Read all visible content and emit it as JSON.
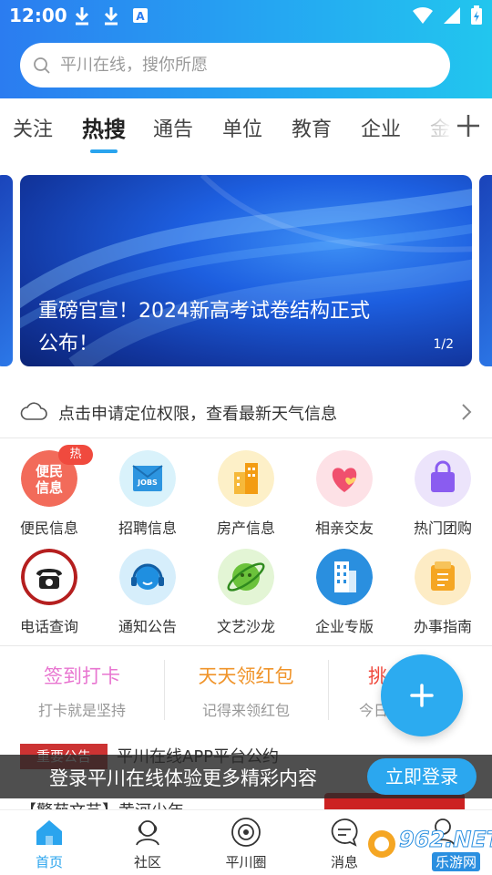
{
  "status_bar": {
    "time": "12:00"
  },
  "search": {
    "placeholder": "平川在线，搜你所愿"
  },
  "tabs": [
    {
      "label": "关注"
    },
    {
      "label": "热搜"
    },
    {
      "label": "通告"
    },
    {
      "label": "单位"
    },
    {
      "label": "教育"
    },
    {
      "label": "企业"
    },
    {
      "label": "金"
    }
  ],
  "active_tab": "热搜",
  "banner": {
    "title": "重磅官宣！2024新高考试卷结构正式公布！",
    "counter": "1/2"
  },
  "weather": {
    "text": "点击申请定位权限，查看最新天气信息"
  },
  "grid": {
    "items": [
      {
        "label": "便民信息",
        "icon": "convenience-info-icon",
        "badge": "热",
        "icon_text": "便民信息"
      },
      {
        "label": "招聘信息",
        "icon": "jobs-icon",
        "icon_text": "JOBS"
      },
      {
        "label": "房产信息",
        "icon": "building-icon"
      },
      {
        "label": "相亲交友",
        "icon": "heart-icon"
      },
      {
        "label": "热门团购",
        "icon": "shopping-bag-icon"
      },
      {
        "label": "电话查询",
        "icon": "telephone-icon"
      },
      {
        "label": "通知公告",
        "icon": "headset-icon"
      },
      {
        "label": "文艺沙龙",
        "icon": "planet-icon"
      },
      {
        "label": "企业专版",
        "icon": "office-building-icon"
      },
      {
        "label": "办事指南",
        "icon": "guide-icon"
      }
    ]
  },
  "tasks": [
    {
      "title": "签到打卡",
      "subtitle": "打卡就是坚持",
      "color": "#e875d0"
    },
    {
      "title": "天天领红包",
      "subtitle": "记得来领红包",
      "color": "#f0942a"
    },
    {
      "title": "挑",
      "subtitle": "今日",
      "color": "#f04a3e"
    }
  ],
  "feed": {
    "tag": "重要公告",
    "item1": "平川在线APP平台公约",
    "item2": "【警苑文艺】黄河少年"
  },
  "login_prompt": {
    "text": "登录平川在线体验更多精彩内容",
    "button": "立即登录"
  },
  "bottom_nav": [
    {
      "label": "首页",
      "icon": "home-icon"
    },
    {
      "label": "社区",
      "icon": "community-icon"
    },
    {
      "label": "平川圈",
      "icon": "circle-icon"
    },
    {
      "label": "消息",
      "icon": "message-icon"
    },
    {
      "label": "",
      "icon": "profile-icon"
    }
  ],
  "watermark": {
    "text": "962.NET",
    "sub": "乐游网"
  },
  "colors": {
    "accent": "#2aa4ee",
    "header_start": "#2b7cf0",
    "header_end": "#22c6ee"
  }
}
